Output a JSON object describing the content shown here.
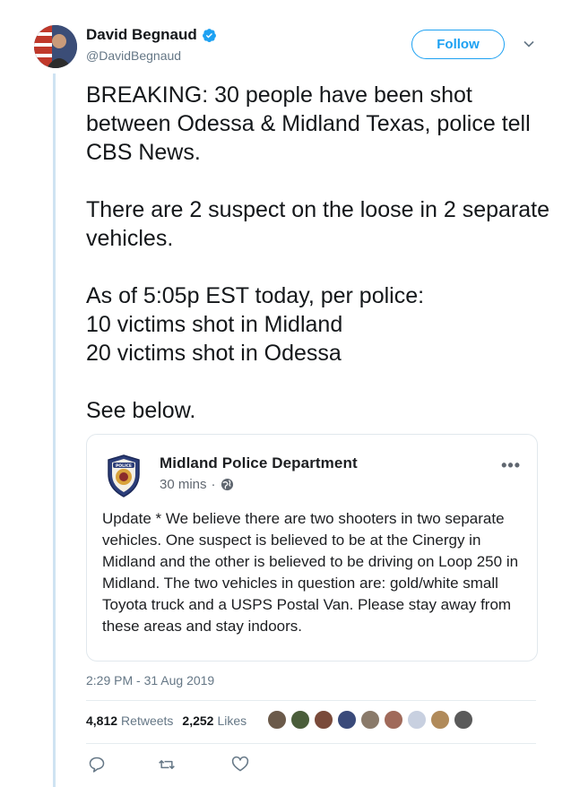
{
  "author": {
    "name": "David Begnaud",
    "handle": "@DavidBegnaud",
    "verified": true
  },
  "follow_label": "Follow",
  "tweet": {
    "paragraphs": [
      "BREAKING: 30 people have been shot between Odessa & Midland Texas, police tell CBS News.",
      "There are 2 suspect on the loose in 2 separate vehicles.",
      "As of 5:05p EST today, per police:\n10 victims shot in Midland\n20 victims shot in Odessa",
      "See below."
    ]
  },
  "embedded_post": {
    "page_name": "Midland Police Department",
    "time": "30 mins",
    "separator": "·",
    "logo_text": "POLICE",
    "more_label": "•••",
    "body": "Update * We believe there are two shooters in two separate vehicles. One suspect is believed to be at the Cinergy in Midland and the other is believed to be driving on Loop 250 in Midland. The two vehicles in question are: gold/white small Toyota truck and a USPS Postal Van. Please stay away from these areas and stay indoors."
  },
  "timestamp": "2:29 PM - 31 Aug 2019",
  "stats": {
    "retweets_count": "4,812",
    "retweets_label": "Retweets",
    "likes_count": "2,252",
    "likes_label": "Likes"
  },
  "colors": {
    "accent": "#1da1f2",
    "thread_line": "#cfe3f2",
    "secondary_text": "#657786"
  },
  "icons": {
    "verified": "verified-badge-icon",
    "caret": "chevron-down-icon",
    "reply": "reply-icon",
    "retweet": "retweet-icon",
    "like": "heart-icon",
    "globe": "globe-icon"
  },
  "liker_avatar_colors": [
    "#6b5a4a",
    "#4a5d3a",
    "#7a4a3a",
    "#3a4a7a",
    "#8a7a6a",
    "#a06a5a",
    "#c8d0e0",
    "#b08a5a",
    "#5a5a5a"
  ]
}
